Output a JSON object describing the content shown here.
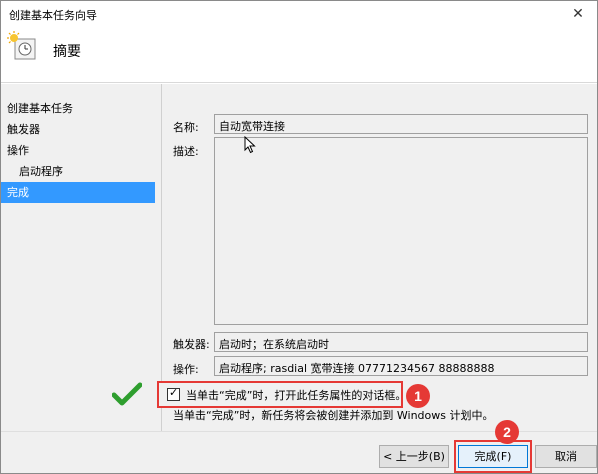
{
  "window": {
    "title": "创建基本任务向导",
    "close": "✕"
  },
  "header": {
    "title": "摘要"
  },
  "sidebar": {
    "items": [
      {
        "label": "创建基本任务",
        "level": 0,
        "active": false
      },
      {
        "label": "触发器",
        "level": 0,
        "active": false
      },
      {
        "label": "操作",
        "level": 0,
        "active": false
      },
      {
        "label": "启动程序",
        "level": 1,
        "active": false
      },
      {
        "label": "完成",
        "level": 0,
        "active": true
      }
    ]
  },
  "summary": {
    "name_label": "名称:",
    "name_value": "自动宽带连接",
    "desc_label": "描述:",
    "desc_value": "",
    "trigger_label": "触发器:",
    "trigger_value": "启动时；在系统启动时",
    "action_label": "操作:",
    "action_value": "启动程序; rasdial 宽带连接 07771234567  88888888"
  },
  "open_properties": {
    "checked": true,
    "label": "当单击“完成”时，打开此任务属性的对话框。"
  },
  "note": "当单击“完成”时，新任务将会被创建并添加到 Windows 计划中。",
  "annotations": {
    "step1": "1",
    "step2": "2"
  },
  "buttons": {
    "back": "< 上一步(B)",
    "finish": "完成(F)",
    "cancel": "取消"
  },
  "colors": {
    "selection": "#3399ff",
    "annotation_red": "#e53935",
    "check_green": "#2e9e2e"
  }
}
